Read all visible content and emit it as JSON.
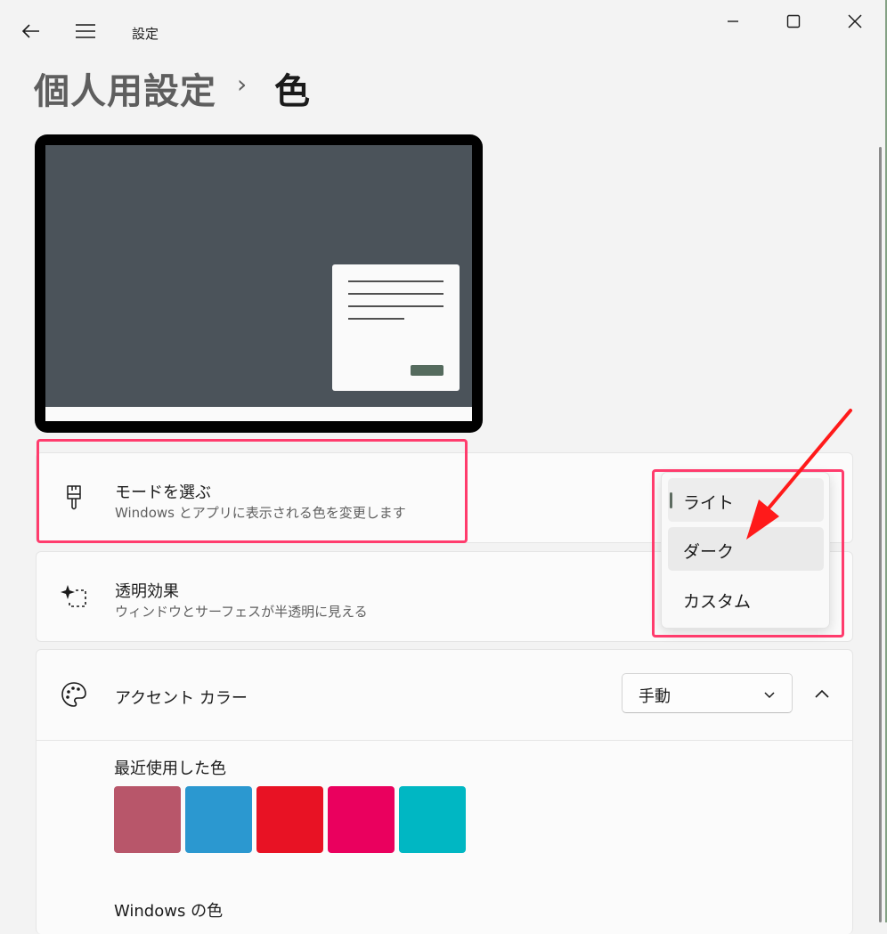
{
  "window": {
    "app_title": "設定"
  },
  "breadcrumb": {
    "parent": "個人用設定",
    "separator": "›",
    "current": "色"
  },
  "mode_card": {
    "title": "モードを選ぶ",
    "subtitle": "Windows とアプリに表示される色を変更します"
  },
  "transparency_card": {
    "title": "透明効果",
    "subtitle": "ウィンドウとサーフェスが半透明に見える"
  },
  "accent_card": {
    "title": "アクセント カラー",
    "dropdown_value": "手動"
  },
  "recent_colors": {
    "label": "最近使用した色",
    "swatches": [
      "#b8566a",
      "#2b98d0",
      "#e81224",
      "#ea005e",
      "#00b7c3"
    ]
  },
  "windows_colors": {
    "label": "Windows の色"
  },
  "mode_menu": {
    "items": [
      {
        "label": "ライト",
        "selected": true
      },
      {
        "label": "ダーク",
        "selected": false
      },
      {
        "label": "カスタム",
        "selected": false
      }
    ]
  },
  "colors": {
    "annotation": "#ff3c6d",
    "arrow": "#ff1a1a",
    "preview_desktop": "#4b535a",
    "preview_button": "#556b5e"
  },
  "icons": {
    "back": "arrow-left-icon",
    "menu": "hamburger-icon",
    "minimize": "minimize-icon",
    "maximize": "maximize-icon",
    "close": "close-icon",
    "mode": "paintbrush-icon",
    "transparency": "sparkle-select-icon",
    "accent": "palette-icon",
    "chevron_down": "chevron-down-icon",
    "chevron_up": "chevron-up-icon"
  }
}
